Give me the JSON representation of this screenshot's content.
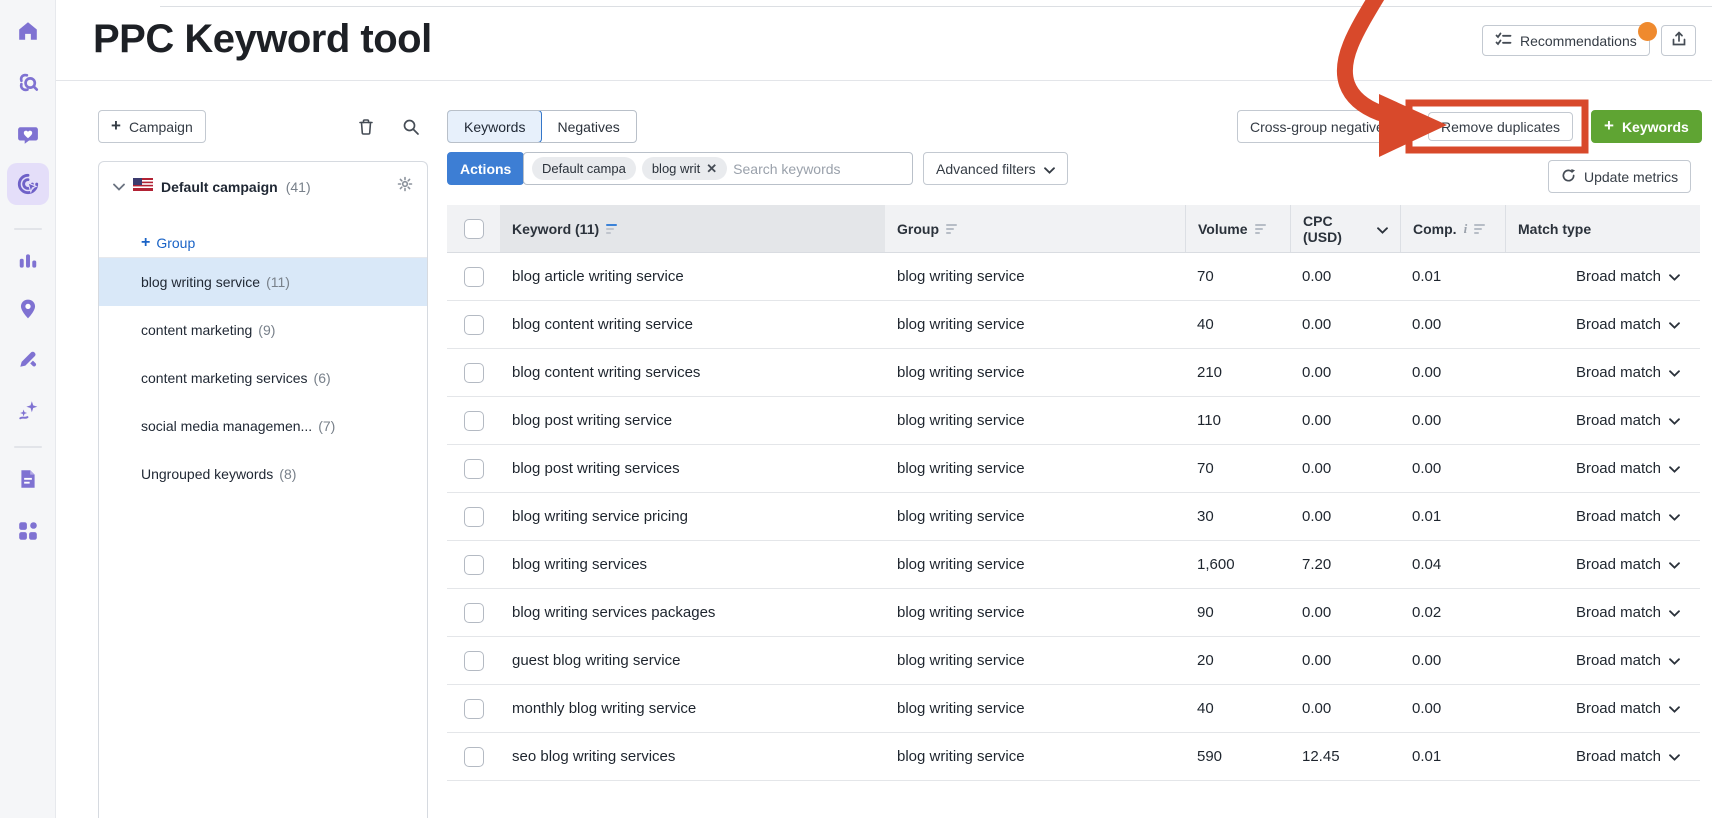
{
  "header": {
    "title": "PPC Keyword tool",
    "recommendations_label": "Recommendations"
  },
  "toolbar": {
    "campaign_label": "Campaign",
    "tabs": {
      "keywords": "Keywords",
      "negatives": "Negatives"
    },
    "cross_group_label": "Cross-group negatives",
    "remove_duplicates_label": "Remove duplicates",
    "add_keywords_label": "Keywords",
    "update_metrics_label": "Update metrics",
    "actions_label": "Actions",
    "search_placeholder": "Search keywords",
    "chips": [
      {
        "label": "Default campa"
      },
      {
        "label": "blog writ"
      }
    ],
    "advanced_filters_label": "Advanced filters"
  },
  "panel": {
    "campaign": {
      "name": "Default campaign",
      "count": "(41)"
    },
    "add_group_label": "Group",
    "groups": [
      {
        "name": "blog writing service",
        "count": "(11)",
        "selected": true
      },
      {
        "name": "content marketing",
        "count": "(9)",
        "selected": false
      },
      {
        "name": "content marketing services",
        "count": "(6)",
        "selected": false
      },
      {
        "name": "social media managemen...",
        "count": "(7)",
        "selected": false
      },
      {
        "name": "Ungrouped keywords",
        "count": "(8)",
        "selected": false
      }
    ]
  },
  "table": {
    "headers": {
      "keyword": "Keyword (11)",
      "group": "Group",
      "volume": "Volume",
      "cpc": "CPC (USD)",
      "comp": "Comp.",
      "match": "Match type"
    },
    "rows": [
      {
        "keyword": "blog article writing service",
        "group": "blog writing service",
        "volume": "70",
        "cpc": "0.00",
        "comp": "0.01",
        "match": "Broad match"
      },
      {
        "keyword": "blog content writing service",
        "group": "blog writing service",
        "volume": "40",
        "cpc": "0.00",
        "comp": "0.00",
        "match": "Broad match"
      },
      {
        "keyword": "blog content writing services",
        "group": "blog writing service",
        "volume": "210",
        "cpc": "0.00",
        "comp": "0.00",
        "match": "Broad match"
      },
      {
        "keyword": "blog post writing service",
        "group": "blog writing service",
        "volume": "110",
        "cpc": "0.00",
        "comp": "0.00",
        "match": "Broad match"
      },
      {
        "keyword": "blog post writing services",
        "group": "blog writing service",
        "volume": "70",
        "cpc": "0.00",
        "comp": "0.00",
        "match": "Broad match"
      },
      {
        "keyword": "blog writing service pricing",
        "group": "blog writing service",
        "volume": "30",
        "cpc": "0.00",
        "comp": "0.01",
        "match": "Broad match"
      },
      {
        "keyword": "blog writing services",
        "group": "blog writing service",
        "volume": "1,600",
        "cpc": "7.20",
        "comp": "0.04",
        "match": "Broad match"
      },
      {
        "keyword": "blog writing services packages",
        "group": "blog writing service",
        "volume": "90",
        "cpc": "0.00",
        "comp": "0.02",
        "match": "Broad match"
      },
      {
        "keyword": "guest blog writing service",
        "group": "blog writing service",
        "volume": "20",
        "cpc": "0.00",
        "comp": "0.00",
        "match": "Broad match"
      },
      {
        "keyword": "monthly blog writing service",
        "group": "blog writing service",
        "volume": "40",
        "cpc": "0.00",
        "comp": "0.00",
        "match": "Broad match"
      },
      {
        "keyword": "seo blog writing services",
        "group": "blog writing service",
        "volume": "590",
        "cpc": "12.45",
        "comp": "0.01",
        "match": "Broad match"
      }
    ]
  },
  "annotation": {
    "color": "#d8492b"
  },
  "colors": {
    "accent_blue": "#3d7ed4",
    "accent_green": "#5fa433",
    "link_blue": "#1a63c6",
    "selected_row": "#d9e8f8",
    "sidebar_purple": "#7f72d2",
    "badge_orange": "#ef8a2e",
    "annotation_red": "#d8492b"
  },
  "sidebar": {
    "items": [
      {
        "icon": "home"
      },
      {
        "icon": "keyword-research"
      },
      {
        "icon": "social-media"
      },
      {
        "icon": "ppc-keyword-tool",
        "selected": true
      },
      {
        "icon": "analytics"
      },
      {
        "icon": "local-listings"
      },
      {
        "icon": "content-writing"
      },
      {
        "icon": "ai-tools"
      },
      {
        "icon": "reports"
      },
      {
        "icon": "apps"
      }
    ]
  }
}
